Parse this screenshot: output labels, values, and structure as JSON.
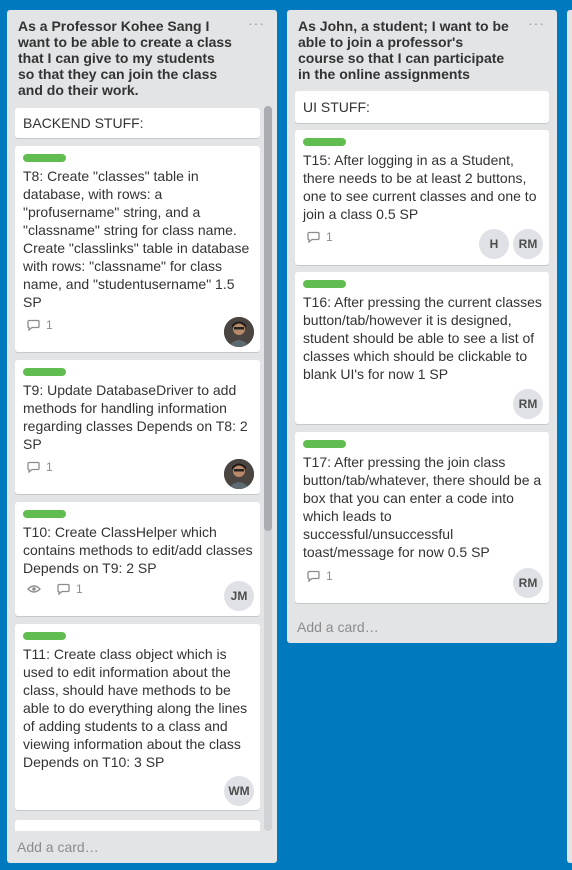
{
  "lists": [
    {
      "title": "As a Professor Kohee Sang I want to be able to create a class that I can give to my students so that they can join the class and do their work.",
      "title_lines": [
        "As a Professor Kohee Sang I",
        "want to be able to create a class",
        "that I can give to my students",
        "so that they can join the class",
        "and do their work."
      ],
      "menu": "···",
      "cards": [
        {
          "text": "BACKEND STUFF:"
        },
        {
          "text": "T8: Create \"classes\" table in database, with rows: a \"profusername\" string, and a \"classname\" string for class name. Create \"classlinks\" table in database with rows: \"classname\" for class name, and \"studentusername\" 1.5 SP",
          "comments": "1",
          "label": "green",
          "member": "photo"
        },
        {
          "text": "T9: Update DatabaseDriver to add methods for handling information regarding classes Depends on T8: 2 SP",
          "comments": "1",
          "label": "green",
          "member": "photo"
        },
        {
          "text": "T10: Create ClassHelper which contains methods to edit/add classes Depends on T9: 2 SP",
          "comments": "1",
          "watching": true,
          "label": "green",
          "member": "JM"
        },
        {
          "text": "T11: Create class object which is used to edit information about the class, should have methods to be able to do everything along the lines of adding students to a class and viewing information about the class Depends on T10: 3 SP",
          "label": "green",
          "member": "WM"
        }
      ],
      "add_card": "Add a card…"
    },
    {
      "title": "As John, a student; I want to be able to join a professor's course so that I can participate in the online assignments",
      "title_lines": [
        "As John, a student; I want to be",
        "able to join a professor's",
        "course so that I can participate",
        "in the online assignments"
      ],
      "menu": "···",
      "cards": [
        {
          "text": "UI STUFF:"
        },
        {
          "text": "T15: After logging in as a Student, there needs to be at least 2 buttons, one to see current classes and one to join a class 0.5 SP",
          "comments": "1",
          "label": "green",
          "members": [
            "H",
            "RM"
          ]
        },
        {
          "text": "T16: After pressing the current classes button/tab/however it is designed, student should be able to see a list of classes which should be clickable to blank UI's for now 1 SP",
          "label": "green",
          "members": [
            "RM"
          ]
        },
        {
          "text": "T17: After pressing the join class button/tab/whatever, there should be a box that you can enter a code into which leads to successful/unsuccessful toast/message for now 0.5 SP",
          "comments": "1",
          "label": "green",
          "members": [
            "RM"
          ]
        }
      ],
      "add_card": "Add a card…"
    }
  ],
  "colors": {
    "board": "#0079bf",
    "list": "#e2e4e6",
    "label_green": "#61bd4f"
  }
}
